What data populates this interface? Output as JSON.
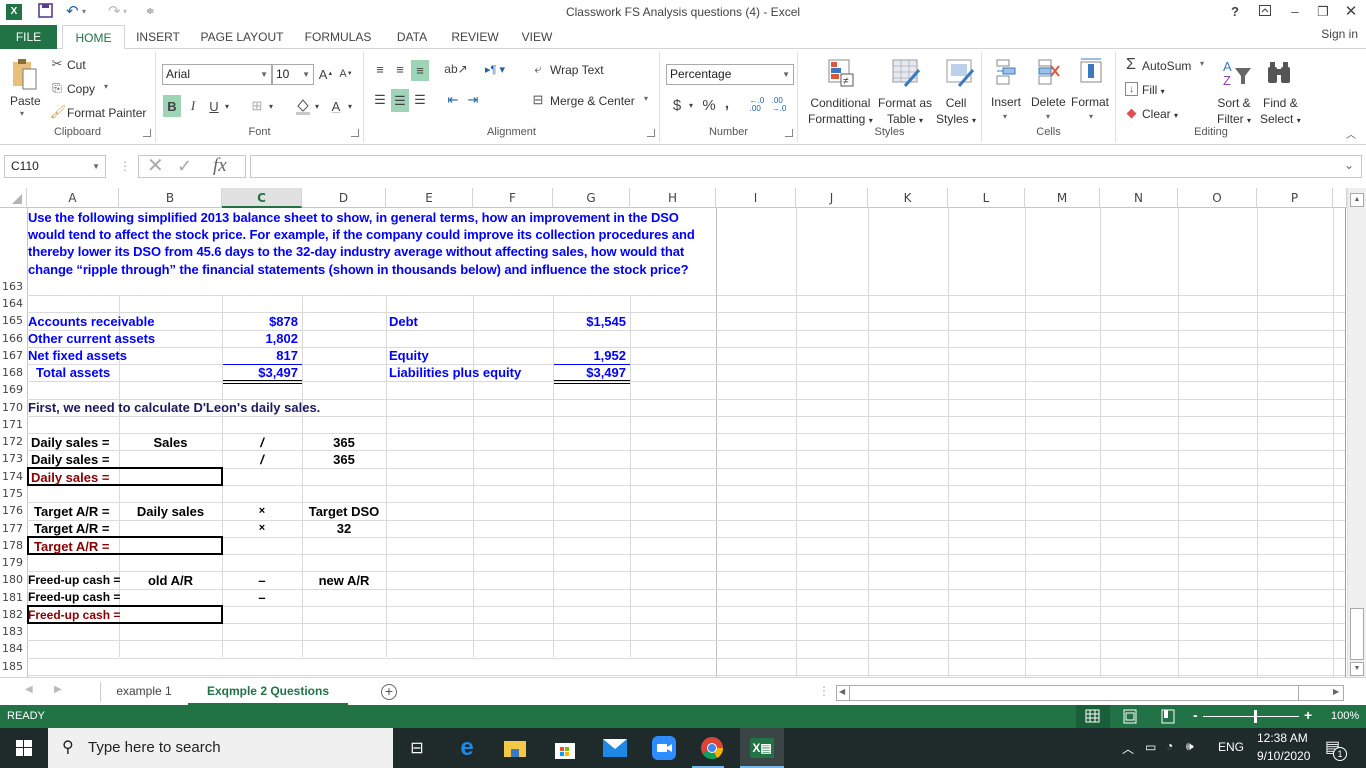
{
  "window": {
    "title": "Classwork FS Analysis questions (4) - Excel",
    "controls": [
      "?",
      "restore-ribbon",
      "minimize",
      "restore",
      "close"
    ]
  },
  "quick_access": {
    "icons": [
      "excel-logo-icon",
      "save-icon",
      "undo-icon",
      "redo-icon",
      "customize-icon"
    ]
  },
  "tabs": [
    {
      "label": "FILE"
    },
    {
      "label": "HOME",
      "active": true
    },
    {
      "label": "INSERT"
    },
    {
      "label": "PAGE LAYOUT"
    },
    {
      "label": "FORMULAS"
    },
    {
      "label": "DATA"
    },
    {
      "label": "REVIEW"
    },
    {
      "label": "VIEW"
    }
  ],
  "sign_in": "Sign in",
  "ribbon": {
    "clipboard": {
      "label": "Clipboard",
      "paste": "Paste",
      "cut": "Cut",
      "copy": "Copy",
      "format_painter": "Format Painter"
    },
    "font": {
      "label": "Font",
      "font_name": "Arial",
      "font_size": "10",
      "bold": "B",
      "italic": "I",
      "underline": "U"
    },
    "alignment": {
      "label": "Alignment",
      "wrap_text": "Wrap Text",
      "merge_center": "Merge & Center"
    },
    "number": {
      "label": "Number",
      "format": "Percentage",
      "currency": "$",
      "percent": "%",
      "comma": ","
    },
    "styles": {
      "label": "Styles",
      "conditional_1": "Conditional",
      "conditional_2": "Formatting",
      "format_table_1": "Format as",
      "format_table_2": "Table",
      "cell_styles_1": "Cell",
      "cell_styles_2": "Styles"
    },
    "cells": {
      "label": "Cells",
      "insert": "Insert",
      "delete": "Delete",
      "format": "Format"
    },
    "editing": {
      "label": "Editing",
      "autosum": "AutoSum",
      "fill": "Fill",
      "clear": "Clear",
      "sort_1": "Sort &",
      "sort_2": "Filter",
      "find_1": "Find &",
      "find_2": "Select"
    }
  },
  "formula_bar": {
    "name_box": "C110",
    "formula": "",
    "fx": "fx"
  },
  "columns": [
    "A",
    "B",
    "C",
    "D",
    "E",
    "F",
    "G",
    "H",
    "I",
    "J",
    "K",
    "L",
    "M",
    "N",
    "O",
    "P"
  ],
  "selected_column": "C",
  "rows": [
    "163",
    "164",
    "165",
    "166",
    "167",
    "168",
    "169",
    "170",
    "171",
    "172",
    "173",
    "174",
    "175",
    "176",
    "177",
    "178",
    "179",
    "180",
    "181",
    "182",
    "183",
    "184",
    "185"
  ],
  "sheet": {
    "intro": "Use the following simplified 2013 balance sheet to show, in general terms, how an improvement in the DSO would tend to affect the stock price.  For example, if the company could improve its collection procedures and thereby lower its DSO from 45.6 days to the 32-day industry average without affecting sales, how would that change “ripple through” the financial statements (shown in thousands below) and influence the stock price?",
    "balance_sheet": {
      "assets": [
        {
          "label": "Accounts receivable",
          "value": "$878"
        },
        {
          "label": "Other current assets",
          "value": "1,802"
        },
        {
          "label": "Net fixed assets",
          "value": "817"
        },
        {
          "label": "Total assets",
          "value": "$3,497"
        }
      ],
      "liabilities": [
        {
          "label": "Debt",
          "value": "$1,545"
        },
        {
          "label": "Equity",
          "value": "1,952"
        },
        {
          "label": "Liabilities plus equity",
          "value": "$3,497"
        }
      ]
    },
    "step1": "First, we need to calculate D'Leon's daily sales.",
    "daily_sales": {
      "label": "Daily sales  =",
      "sales": "Sales",
      "divide": "/",
      "days": "365"
    },
    "target_ar": {
      "label": "Target A/R =",
      "daily_sales": "Daily sales",
      "times": "×",
      "target_dso_label": "Target DSO",
      "target_dso": "32"
    },
    "freed_cash": {
      "label": "Freed-up cash =",
      "old_ar": "old A/R",
      "minus": "–",
      "new_ar": "new A/R"
    }
  },
  "sheet_tabs": [
    {
      "label": "example 1"
    },
    {
      "label": "Exqmple 2 Questions",
      "active": true
    }
  ],
  "status": {
    "mode": "READY",
    "zoom": "100%",
    "zoom_percent": 100
  },
  "taskbar": {
    "search_placeholder": "Type here to search",
    "time": "12:38 AM",
    "date": "9/10/2020",
    "language": "ENG",
    "notifications": "1"
  },
  "colors": {
    "excel_green": "#217346",
    "cell_blue": "#0000ff",
    "cell_dark_red": "#8b0000"
  }
}
